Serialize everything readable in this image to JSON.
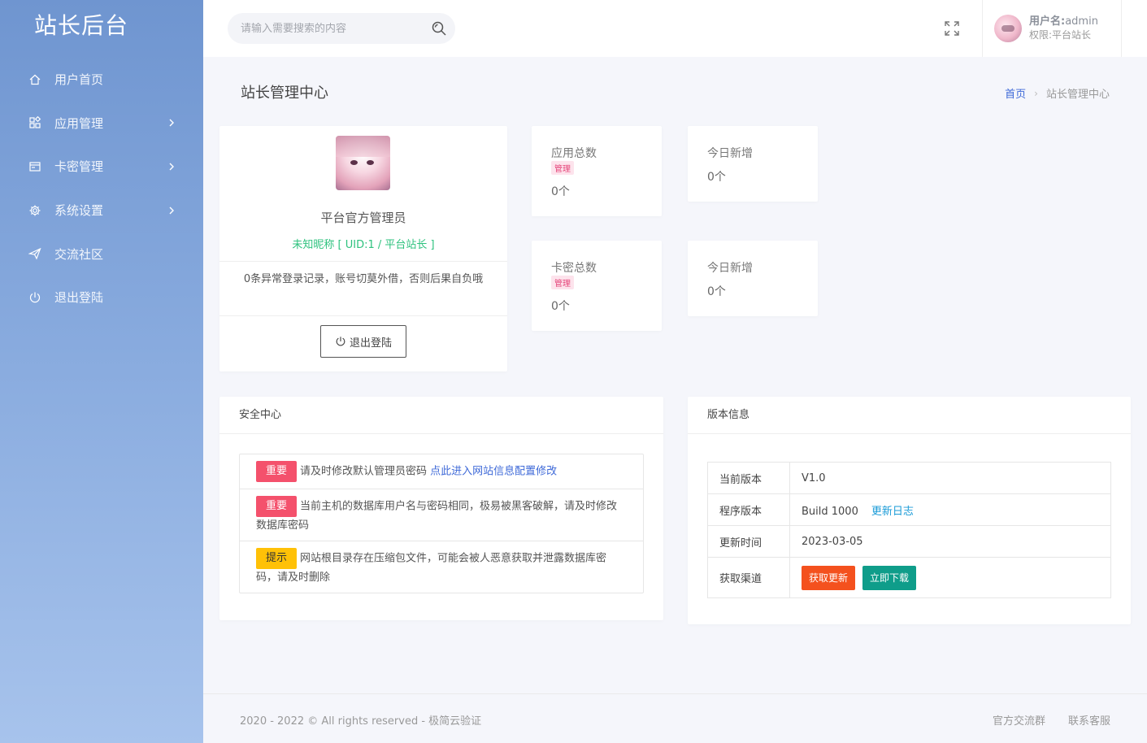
{
  "sidebar": {
    "brand": "站长后台",
    "items": [
      {
        "label": "用户首页",
        "icon": "home-icon",
        "has_sub": false
      },
      {
        "label": "应用管理",
        "icon": "apps-icon",
        "has_sub": true
      },
      {
        "label": "卡密管理",
        "icon": "card-icon",
        "has_sub": true
      },
      {
        "label": "系统设置",
        "icon": "gear-icon",
        "has_sub": true
      },
      {
        "label": "交流社区",
        "icon": "send-icon",
        "has_sub": false
      },
      {
        "label": "退出登陆",
        "icon": "power-icon",
        "has_sub": false
      }
    ]
  },
  "topbar": {
    "search_placeholder": "请输入需要搜索的内容",
    "user_label": "用户名:",
    "username": "admin",
    "role": "权限:平台站长"
  },
  "page": {
    "title": "站长管理中心",
    "breadcrumb_home": "首页",
    "breadcrumb_current": "站长管理中心"
  },
  "profile": {
    "name": "平台官方管理员",
    "uid_line": "未知昵称 [ UID:1 / 平台站长 ]",
    "notice": "0条异常登录记录，账号切莫外借，否则后果自负哦",
    "logout_label": "退出登陆"
  },
  "stats": {
    "apps_total": {
      "title": "应用总数",
      "badge": "管理",
      "value": "0个"
    },
    "apps_today": {
      "title": "今日新增",
      "value": "0个"
    },
    "cards_total": {
      "title": "卡密总数",
      "badge": "管理",
      "value": "0个"
    },
    "cards_today": {
      "title": "今日新增",
      "value": "0个"
    }
  },
  "security": {
    "title": "安全中心",
    "items": [
      {
        "tag": "重要",
        "text": "请及时修改默认管理员密码 ",
        "link": "点此进入网站信息配置修改"
      },
      {
        "tag": "重要",
        "text": "当前主机的数据库用户名与密码相同，极易被黑客破解，请及时修改数据库密码"
      },
      {
        "tag": "提示",
        "text": "网站根目录存在压缩包文件，可能会被人恶意获取并泄露数据库密码，请及时删除"
      }
    ]
  },
  "version": {
    "title": "版本信息",
    "rows": [
      {
        "key": "当前版本",
        "value": "V1.0"
      },
      {
        "key": "程序版本",
        "value": "Build 1000",
        "link": "更新日志"
      },
      {
        "key": "更新时间",
        "value": "2023-03-05"
      },
      {
        "key": "获取渠道",
        "btn_update": "获取更新",
        "btn_download": "立即下载"
      }
    ]
  },
  "footer": {
    "copyright": "2020 - 2022 © All rights reserved - 极简云验证",
    "link_group": "官方交流群",
    "link_service": "联系客服"
  },
  "colors": {
    "sidebar_top": "#6f95d0",
    "sidebar_bottom": "#a7c3ec",
    "accent_blue": "#3f6ad8",
    "tag_red": "#f4516c",
    "tag_yellow": "#ffc107",
    "btn_orange": "#f4511e",
    "btn_teal": "#0f9d8a",
    "uid_green": "#2ec27e"
  }
}
